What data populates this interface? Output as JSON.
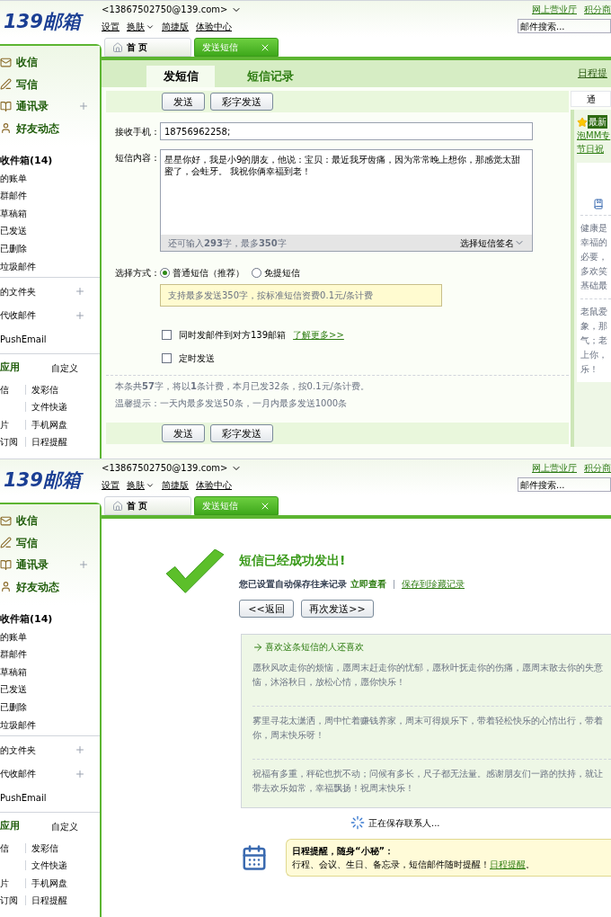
{
  "screens": [
    {
      "header": {
        "logo": "139邮箱",
        "account": "<13867502750@139.com>",
        "links": [
          {
            "label": "设置",
            "menu": false
          },
          {
            "label": "换肤",
            "menu": true
          },
          {
            "label": "简捷版",
            "menu": false
          },
          {
            "label": "体验中心",
            "menu": false
          }
        ],
        "top_links": [
          "网上营业厅",
          "积分商"
        ],
        "search": {
          "placeholder": "邮件搜索..."
        }
      },
      "tabs": [
        {
          "label": "首 页",
          "selected": false,
          "closable": false
        },
        {
          "label": "发送短信",
          "selected": true,
          "closable": true
        }
      ],
      "sidebar": {
        "main": [
          {
            "label": "收信",
            "kind": "inbox",
            "plus": false
          },
          {
            "label": "写信",
            "kind": "write",
            "plus": false
          },
          {
            "label": "通讯录",
            "kind": "contacts",
            "plus": true
          },
          {
            "label": "好友动态",
            "kind": "friends",
            "plus": false
          }
        ],
        "folders": [
          {
            "label": "收件箱(14)",
            "bold": true
          },
          {
            "label": "的账单",
            "bold": false
          },
          {
            "label": "群邮件",
            "bold": false
          },
          {
            "label": "草稿箱",
            "bold": false
          },
          {
            "label": "已发送",
            "bold": false
          },
          {
            "label": "已删除",
            "bold": false
          },
          {
            "label": "垃圾邮件",
            "bold": false
          }
        ],
        "sections": [
          {
            "label": "的文件夹",
            "plus": true
          },
          {
            "label": "代收邮件",
            "plus": true
          },
          {
            "label": "PushEmail",
            "plus": false
          }
        ],
        "apps": {
          "title": "应用",
          "action": "自定义",
          "rows": [
            {
              "left": "信",
              "right": "发彩信"
            },
            {
              "right": "文件快递"
            },
            {
              "left": "片",
              "right": "手机网盘"
            },
            {
              "left": "订阅",
              "right": "日程提醒"
            }
          ]
        }
      },
      "main": {
        "kind": "compose",
        "subtabs": [
          {
            "label": "发短信",
            "selected": true
          },
          {
            "label": "短信记录",
            "selected": false
          }
        ],
        "schedule_link": "日程提",
        "toolbar_buttons": [
          "发送",
          "彩字发送"
        ],
        "recipient": {
          "label": "接收手机：",
          "value": "18756962258;"
        },
        "content": {
          "label": "短信内容：",
          "value": "星星你好，我是小9的朋友，他说：宝贝：最近我牙齿痛，因为常常晚上想你，那感觉太甜蜜了，会蛀牙。 我祝你俩幸福到老！",
          "counter": "还可输入**293**字，最多**350**字",
          "signature": "选择短信签名"
        },
        "method": {
          "label": "选择方式：",
          "options": [
            {
              "label": "普通短信（推荐）",
              "selected": true
            },
            {
              "label": "免提短信",
              "selected": false
            }
          ],
          "tip": "支持最多发送350字，按标准短信资费0.1元/条计费"
        },
        "options": [
          {
            "label": "同时发邮件到对方139邮箱",
            "link": "了解更多>>",
            "checked": false
          },
          {
            "label": "定时发送",
            "checked": false
          }
        ],
        "info": [
          "本条共**57**字，将以**1**条计费，本月已发32条，按0.1元/条计费。",
          "温馨提示：一天内最多发送50条，一月内最多发送1000条"
        ],
        "bottom_buttons": [
          "发送",
          "彩字发送"
        ],
        "side_panel": {
          "tab": "通",
          "badge": "最新",
          "links": [
            "泡MM专",
            "节日祝"
          ],
          "notes": [
            [
              "健康是",
              "幸福的",
              "必要，",
              "多欢笑",
              "基础最"
            ],
            [
              "老鼠爱",
              "象，那",
              "气；老",
              "上你，",
              "乐！"
            ]
          ]
        }
      }
    },
    {
      "header": {
        "logo": "139邮箱",
        "account": "<13867502750@139.com>",
        "links": [
          {
            "label": "设置",
            "menu": false
          },
          {
            "label": "换肤",
            "menu": true
          },
          {
            "label": "简捷版",
            "menu": false
          },
          {
            "label": "体验中心",
            "menu": false
          }
        ],
        "top_links": [
          "网上营业厅",
          "积分商"
        ],
        "search": {
          "placeholder": "邮件搜索..."
        }
      },
      "tabs": [
        {
          "label": "首 页",
          "selected": false,
          "closable": false
        },
        {
          "label": "发送短信",
          "selected": true,
          "closable": true
        }
      ],
      "sidebar": {
        "main": [
          {
            "label": "收信",
            "kind": "inbox",
            "plus": false
          },
          {
            "label": "写信",
            "kind": "write",
            "plus": false
          },
          {
            "label": "通讯录",
            "kind": "contacts",
            "plus": true
          },
          {
            "label": "好友动态",
            "kind": "friends",
            "plus": false
          }
        ],
        "folders": [
          {
            "label": "收件箱(14)",
            "bold": true
          },
          {
            "label": "的账单",
            "bold": false
          },
          {
            "label": "群邮件",
            "bold": false
          },
          {
            "label": "草稿箱",
            "bold": false
          },
          {
            "label": "已发送",
            "bold": false
          },
          {
            "label": "已删除",
            "bold": false
          },
          {
            "label": "垃圾邮件",
            "bold": false
          }
        ],
        "sections": [
          {
            "label": "的文件夹",
            "plus": true
          },
          {
            "label": "代收邮件",
            "plus": true
          },
          {
            "label": "PushEmail",
            "plus": false
          }
        ],
        "apps": {
          "title": "应用",
          "action": "自定义",
          "rows": [
            {
              "left": "信",
              "right": "发彩信"
            },
            {
              "right": "文件快递"
            },
            {
              "left": "片",
              "right": "手机网盘"
            },
            {
              "left": "订阅",
              "right": "日程提醒"
            }
          ]
        }
      },
      "main": {
        "kind": "success",
        "title": "短信已经成功发出!",
        "note": "您已设置自动保存往来记录",
        "view_link": "立即查看",
        "save_link": "保存到珍藏记录",
        "buttons": [
          "<<返回",
          "再次发送>>"
        ],
        "suggestions": {
          "title": "喜欢这条短信的人还喜欢",
          "items": [
            [
              "愿秋风吹走你的烦恼，愿周末赶走你的忧郁，愿秋叶抚走你的伤痛，愿周末散去你的失意",
              "恼，沐浴秋日，放松心情，愿你快乐！"
            ],
            [
              "雾里寻花太潇洒，周中忙着赚钱养家，周末可得娱乐下，带着轻松快乐的心情出行，带着",
              "你，周末快乐呀！"
            ],
            [
              "祝福有多重，秤砣也扰不动；问候有多长，尺子都无法量。感谢朋友们一路的扶持，就让",
              "带去欢乐如常，幸福飘扬！祝周末快乐！"
            ]
          ]
        },
        "saving": "正在保存联系人...",
        "reminder": {
          "title": "日程提醒，随身“小秘”：",
          "text": "行程、会议、生日、备忘录，短信邮件随时提醒！",
          "link": "日程提醒",
          "end": "。"
        }
      }
    }
  ]
}
